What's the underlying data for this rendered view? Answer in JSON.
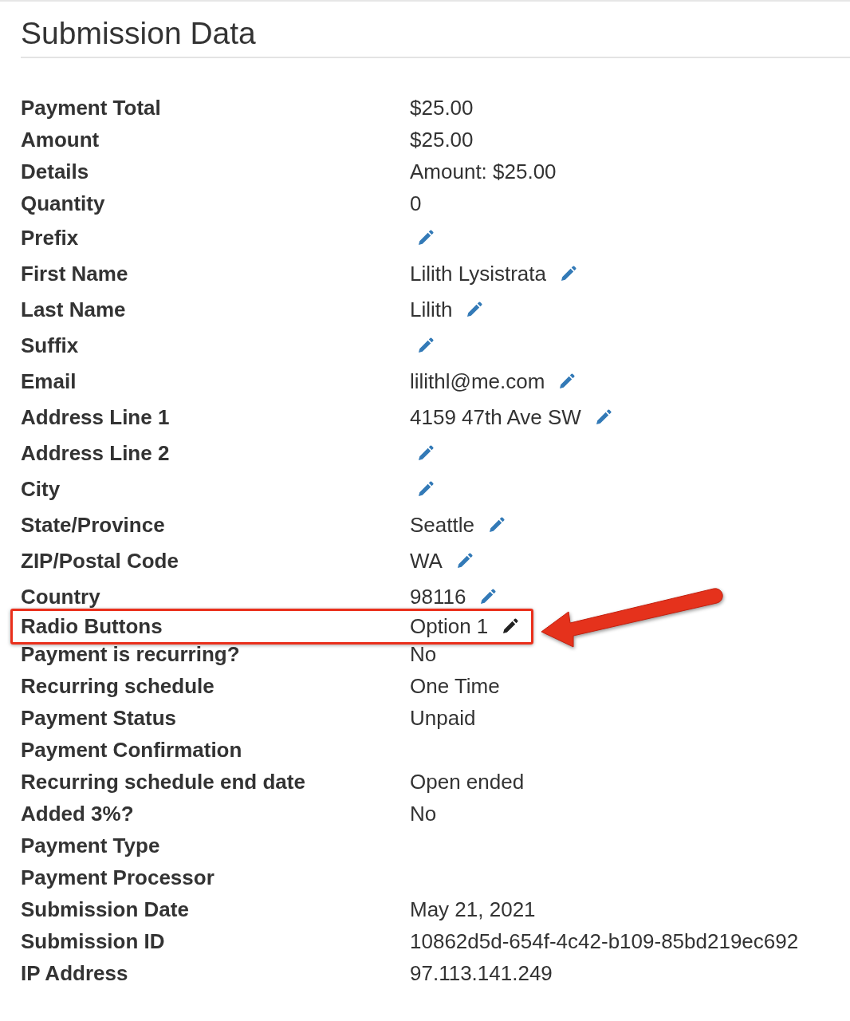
{
  "title": "Submission Data",
  "rows": [
    {
      "label": "Payment Total",
      "value": "$25.00",
      "editable": false,
      "highlighted": false
    },
    {
      "label": "Amount",
      "value": "$25.00",
      "editable": false,
      "highlighted": false
    },
    {
      "label": "Details",
      "value": "Amount: $25.00",
      "editable": false,
      "highlighted": false
    },
    {
      "label": "Quantity",
      "value": "0",
      "editable": false,
      "highlighted": false
    },
    {
      "label": "Prefix",
      "editable": true,
      "highlighted": false
    },
    {
      "label": "First Name",
      "value": "Lilith Lysistrata",
      "editable": true,
      "highlighted": false
    },
    {
      "label": "Last Name",
      "value": "Lilith",
      "editable": true,
      "highlighted": false
    },
    {
      "label": "Suffix",
      "editable": true,
      "highlighted": false
    },
    {
      "label": "Email",
      "value": "lilithl@me.com",
      "editable": true,
      "highlighted": false
    },
    {
      "label": "Address Line 1",
      "value": "4159 47th Ave SW",
      "editable": true,
      "highlighted": false
    },
    {
      "label": "Address Line 2",
      "editable": true,
      "highlighted": false
    },
    {
      "label": "City",
      "editable": true,
      "highlighted": false
    },
    {
      "label": "State/Province",
      "value": "Seattle",
      "editable": true,
      "highlighted": false
    },
    {
      "label": "ZIP/Postal Code",
      "value": "WA",
      "editable": true,
      "highlighted": false
    },
    {
      "label": "Country",
      "value": "98116",
      "editable": true,
      "highlighted": false
    },
    {
      "label": "Radio Buttons",
      "value": "Option 1",
      "editable": true,
      "highlighted": true
    },
    {
      "label": "Payment is recurring?",
      "value": "No",
      "editable": false,
      "highlighted": false
    },
    {
      "label": "Recurring schedule",
      "value": "One Time",
      "editable": false,
      "highlighted": false
    },
    {
      "label": "Payment Status",
      "value": "Unpaid",
      "editable": false,
      "highlighted": false
    },
    {
      "label": "Payment Confirmation",
      "editable": false,
      "highlighted": false
    },
    {
      "label": "Recurring schedule end date",
      "value": "Open ended",
      "editable": false,
      "highlighted": false
    },
    {
      "label": "Added 3%?",
      "value": "No",
      "editable": false,
      "highlighted": false
    },
    {
      "label": "Payment Type",
      "editable": false,
      "highlighted": false
    },
    {
      "label": "Payment Processor",
      "editable": false,
      "highlighted": false
    },
    {
      "label": "Submission Date",
      "value": "May 21, 2021",
      "editable": false,
      "highlighted": false
    },
    {
      "label": "Submission ID",
      "value": "10862d5d-654f-4c42-b109-85bd219ec692",
      "editable": false,
      "highlighted": false
    },
    {
      "label": "IP Address",
      "value": "97.113.141.249",
      "editable": false,
      "highlighted": false
    }
  ]
}
